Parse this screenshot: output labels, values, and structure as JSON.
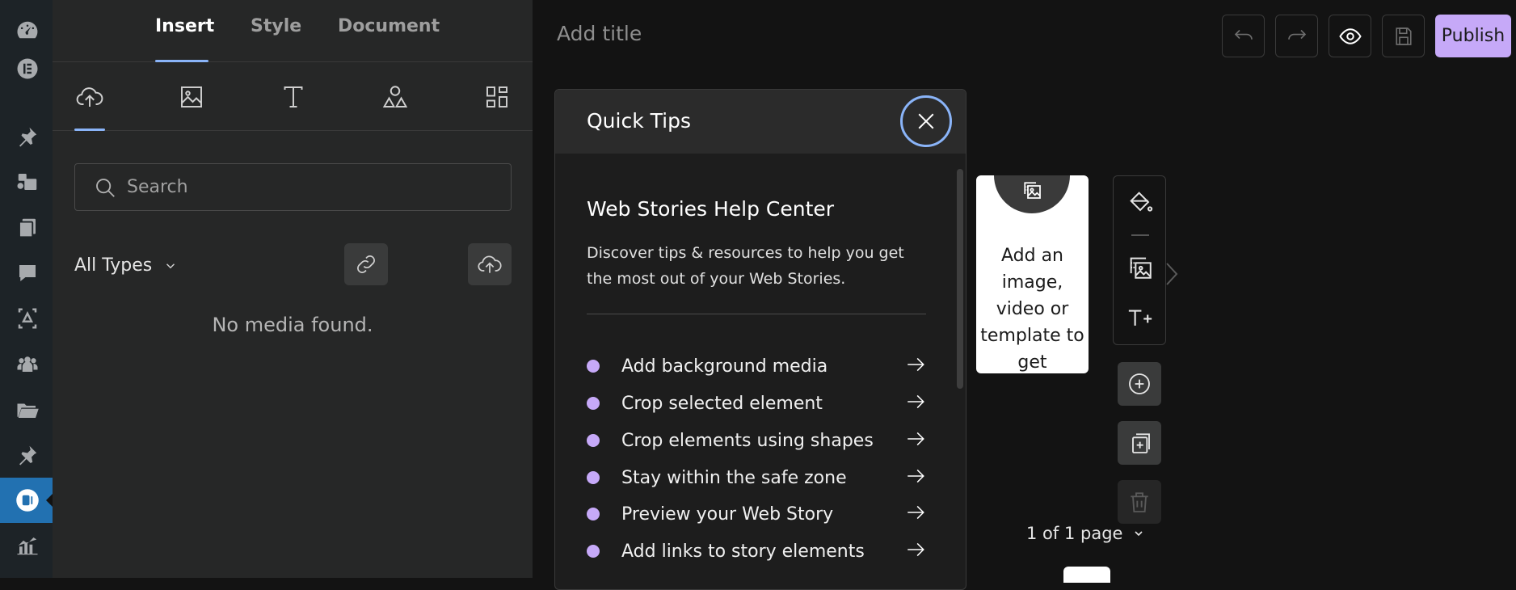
{
  "editor": {
    "tabs": [
      {
        "label": "Insert",
        "active": true
      },
      {
        "label": "Style",
        "active": false
      },
      {
        "label": "Document",
        "active": false
      }
    ],
    "subtabs": [
      "upload-icon",
      "image-icon",
      "text-icon",
      "shapes-icon",
      "templates-icon"
    ],
    "search": {
      "placeholder": "Search"
    },
    "filter": {
      "label": "All Types"
    },
    "empty_message": "No media found.",
    "title_placeholder": "Add title",
    "publish_label": "Publish"
  },
  "quick_tips": {
    "title": "Quick Tips",
    "heading": "Web Stories Help Center",
    "description": "Discover tips & resources to help you get the most out of your Web Stories.",
    "items": [
      "Add background media",
      "Crop selected element",
      "Crop elements using shapes",
      "Stay within the safe zone",
      "Preview your Web Story",
      "Add links to story elements"
    ]
  },
  "canvas": {
    "page_text": "Add an image, video or template to get",
    "page_count": "1 of 1 page"
  },
  "colors": {
    "accent": "#c6a9f8",
    "focus_ring": "#8ab4f8",
    "wp_active": "#2271b1"
  }
}
